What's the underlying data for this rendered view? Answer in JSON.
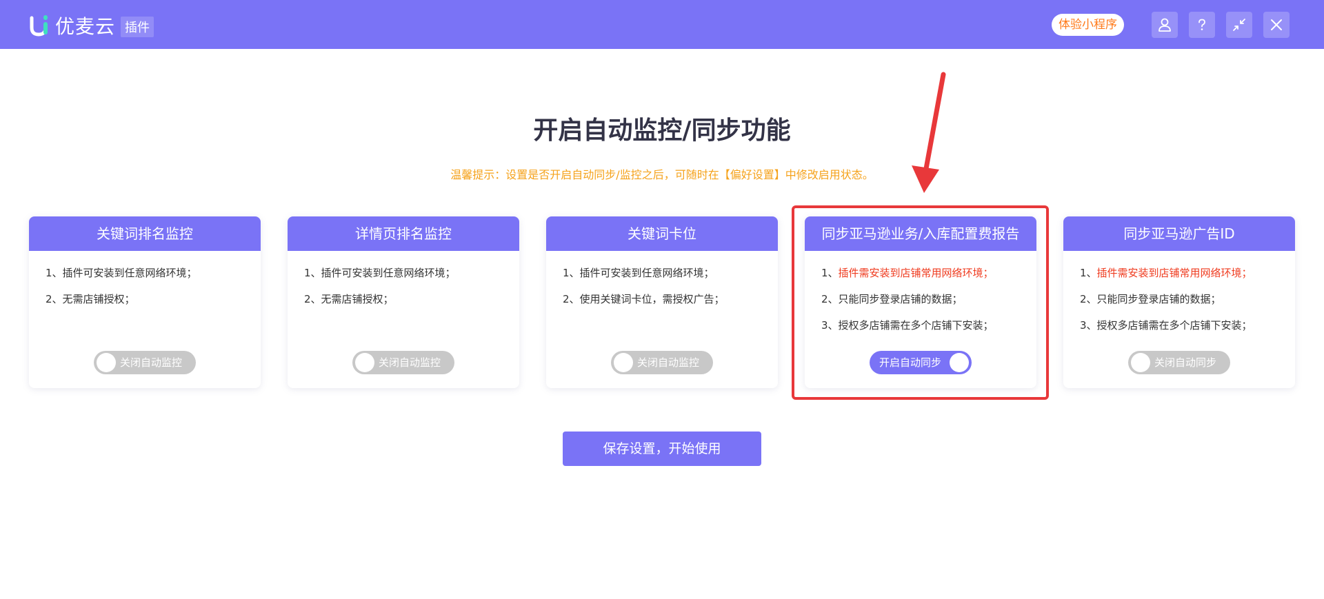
{
  "header": {
    "app_name": "优麦云",
    "plugin_tag": "插件",
    "trial_button": "体验小程序",
    "icons": [
      "user-icon",
      "help-icon",
      "collapse-icon",
      "close-icon"
    ]
  },
  "main": {
    "title": "开启自动监控/同步功能",
    "tip": "温馨提示：设置是否开启自动同步/监控之后，可随时在【偏好设置】中修改启用状态。",
    "cards": [
      {
        "title": "关键词排名监控",
        "lines": [
          {
            "prefix": "1、",
            "text": "插件可安装到任意网络环境；",
            "highlight": false
          },
          {
            "prefix": "2、",
            "text": "无需店铺授权；",
            "highlight": false
          }
        ],
        "toggle_label": "关闭自动监控",
        "toggle_on": false
      },
      {
        "title": "详情页排名监控",
        "lines": [
          {
            "prefix": "1、",
            "text": "插件可安装到任意网络环境；",
            "highlight": false
          },
          {
            "prefix": "2、",
            "text": "无需店铺授权；",
            "highlight": false
          }
        ],
        "toggle_label": "关闭自动监控",
        "toggle_on": false
      },
      {
        "title": "关键词卡位",
        "lines": [
          {
            "prefix": "1、",
            "text": "插件可安装到任意网络环境；",
            "highlight": false
          },
          {
            "prefix": "2、",
            "text": "使用关键词卡位，需授权广告；",
            "highlight": false
          }
        ],
        "toggle_label": "关闭自动监控",
        "toggle_on": false
      },
      {
        "title": "同步亚马逊业务/入库配置费报告",
        "lines": [
          {
            "prefix": "1、",
            "text": "插件需安装到店铺常用网络环境；",
            "highlight": true
          },
          {
            "prefix": "2、",
            "text": "只能同步登录店铺的数据；",
            "highlight": false
          },
          {
            "prefix": "3、",
            "text": "授权多店铺需在多个店铺下安装；",
            "highlight": false
          }
        ],
        "toggle_label": "开启自动同步",
        "toggle_on": true
      },
      {
        "title": "同步亚马逊广告ID",
        "lines": [
          {
            "prefix": "1、",
            "text": "插件需安装到店铺常用网络环境；",
            "highlight": true
          },
          {
            "prefix": "2、",
            "text": "只能同步登录店铺的数据；",
            "highlight": false
          },
          {
            "prefix": "3、",
            "text": "授权多店铺需在多个店铺下安装；",
            "highlight": false
          }
        ],
        "toggle_label": "关闭自动同步",
        "toggle_on": false
      }
    ],
    "save_button": "保存设置，开始使用"
  },
  "colors": {
    "brand": "#7a73f6",
    "tip": "#f5a21b",
    "highlight_text": "#ef3b1f",
    "annotation": "#e8383a",
    "toggle_off": "#c8c8c8"
  }
}
